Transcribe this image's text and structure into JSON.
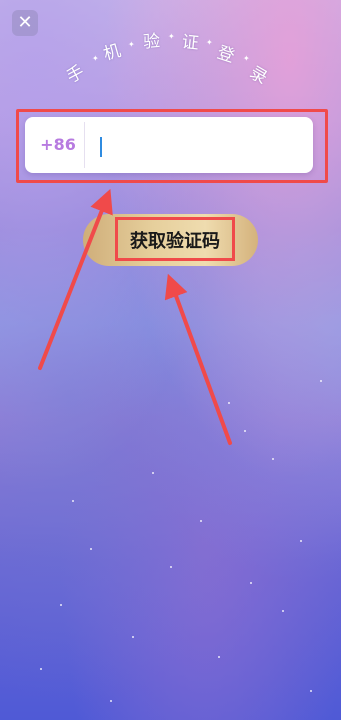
{
  "header": {
    "close_label": "✕",
    "title_chars": [
      "手",
      "机",
      "验",
      "证",
      "登",
      "录"
    ]
  },
  "phone_form": {
    "country_code": "+86",
    "value": "",
    "prefix_color": "#b77be0"
  },
  "get_code_button": {
    "label": "获取验证码"
  },
  "annotations": {
    "highlight_color": "#f04a4a"
  }
}
